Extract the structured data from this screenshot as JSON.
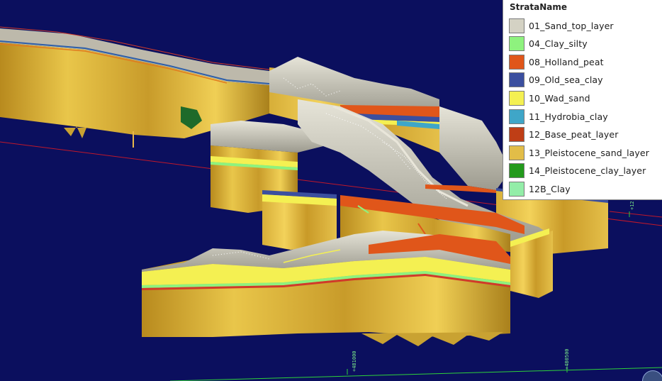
{
  "legend": {
    "title": "StrataName",
    "items": [
      {
        "label": "01_Sand_top_layer",
        "color": "#d4d2c4"
      },
      {
        "label": "04_Clay_silty",
        "color": "#8ef27e"
      },
      {
        "label": "08_Holland_peat",
        "color": "#e0561a"
      },
      {
        "label": "09_Old_sea_clay",
        "color": "#3b4f9f"
      },
      {
        "label": "10_Wad_sand",
        "color": "#f4f052"
      },
      {
        "label": "11_Hydrobia_clay",
        "color": "#3fa6c8"
      },
      {
        "label": "12_Base_peat_layer",
        "color": "#bf3e16"
      },
      {
        "label": "13_Pleistocene_sand_layer",
        "color": "#e2bd48"
      },
      {
        "label": "14_Pleistocene_clay_layer",
        "color": "#239a1c"
      },
      {
        "label": "12B_Clay",
        "color": "#93eda8"
      }
    ]
  },
  "axes": {
    "tick_1": "+481000",
    "tick_2": "+480500",
    "tick_right": "+12"
  },
  "colors": {
    "background": "#0b0f5e",
    "grid_line": "#c0182a",
    "axis_line": "#2ed13a"
  }
}
